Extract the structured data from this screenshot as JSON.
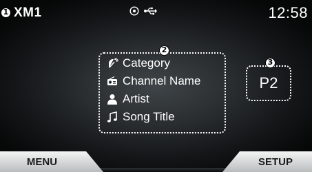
{
  "status": {
    "title": "XM1",
    "time": "12:58"
  },
  "callouts": [
    "1",
    "2",
    "3"
  ],
  "info": {
    "rows": [
      {
        "icon": "satellite-icon",
        "label": "Category"
      },
      {
        "icon": "radio-icon",
        "label": "Channel Name"
      },
      {
        "icon": "person-icon",
        "label": "Artist"
      },
      {
        "icon": "music-note-icon",
        "label": "Song Title"
      }
    ]
  },
  "preset": {
    "label": "P2"
  },
  "softkeys": {
    "menu": "MENU",
    "setup": "SETUP"
  },
  "colors": {
    "text": "#ffffff",
    "softkey_top": "#f4f4f4",
    "softkey_bottom": "#b9bcbe"
  }
}
